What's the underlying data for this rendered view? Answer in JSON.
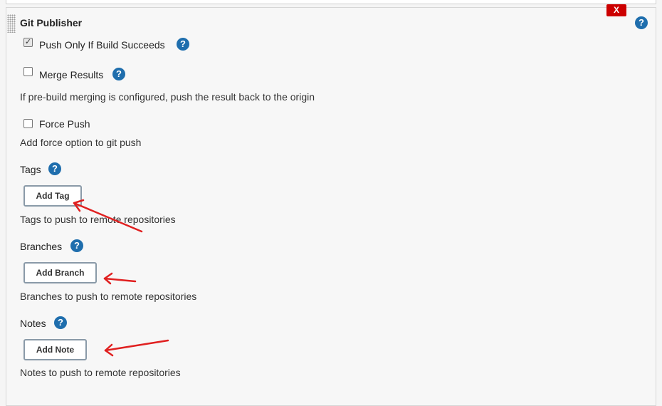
{
  "publisher": {
    "title": "Git Publisher",
    "close_label": "X",
    "help_icon_glyph": "?"
  },
  "options": {
    "push_only": {
      "label": "Push Only If Build Succeeds",
      "checked": true
    },
    "merge_results": {
      "label": "Merge Results",
      "checked": false,
      "description": "If pre-build merging is configured, push the result back to the origin"
    },
    "force_push": {
      "label": "Force Push",
      "checked": false,
      "description": "Add force option to git push"
    }
  },
  "tags": {
    "label": "Tags",
    "button": "Add Tag",
    "description": "Tags to push to remote repositories"
  },
  "branches": {
    "label": "Branches",
    "button": "Add Branch",
    "description": "Branches to push to remote repositories"
  },
  "notes": {
    "label": "Notes",
    "button": "Add Note",
    "description": "Notes to push to remote repositories"
  },
  "annotations": {
    "arrow_color": "#e02020"
  },
  "colors": {
    "help_blue": "#1f6ead",
    "close_red": "#cc0000"
  }
}
